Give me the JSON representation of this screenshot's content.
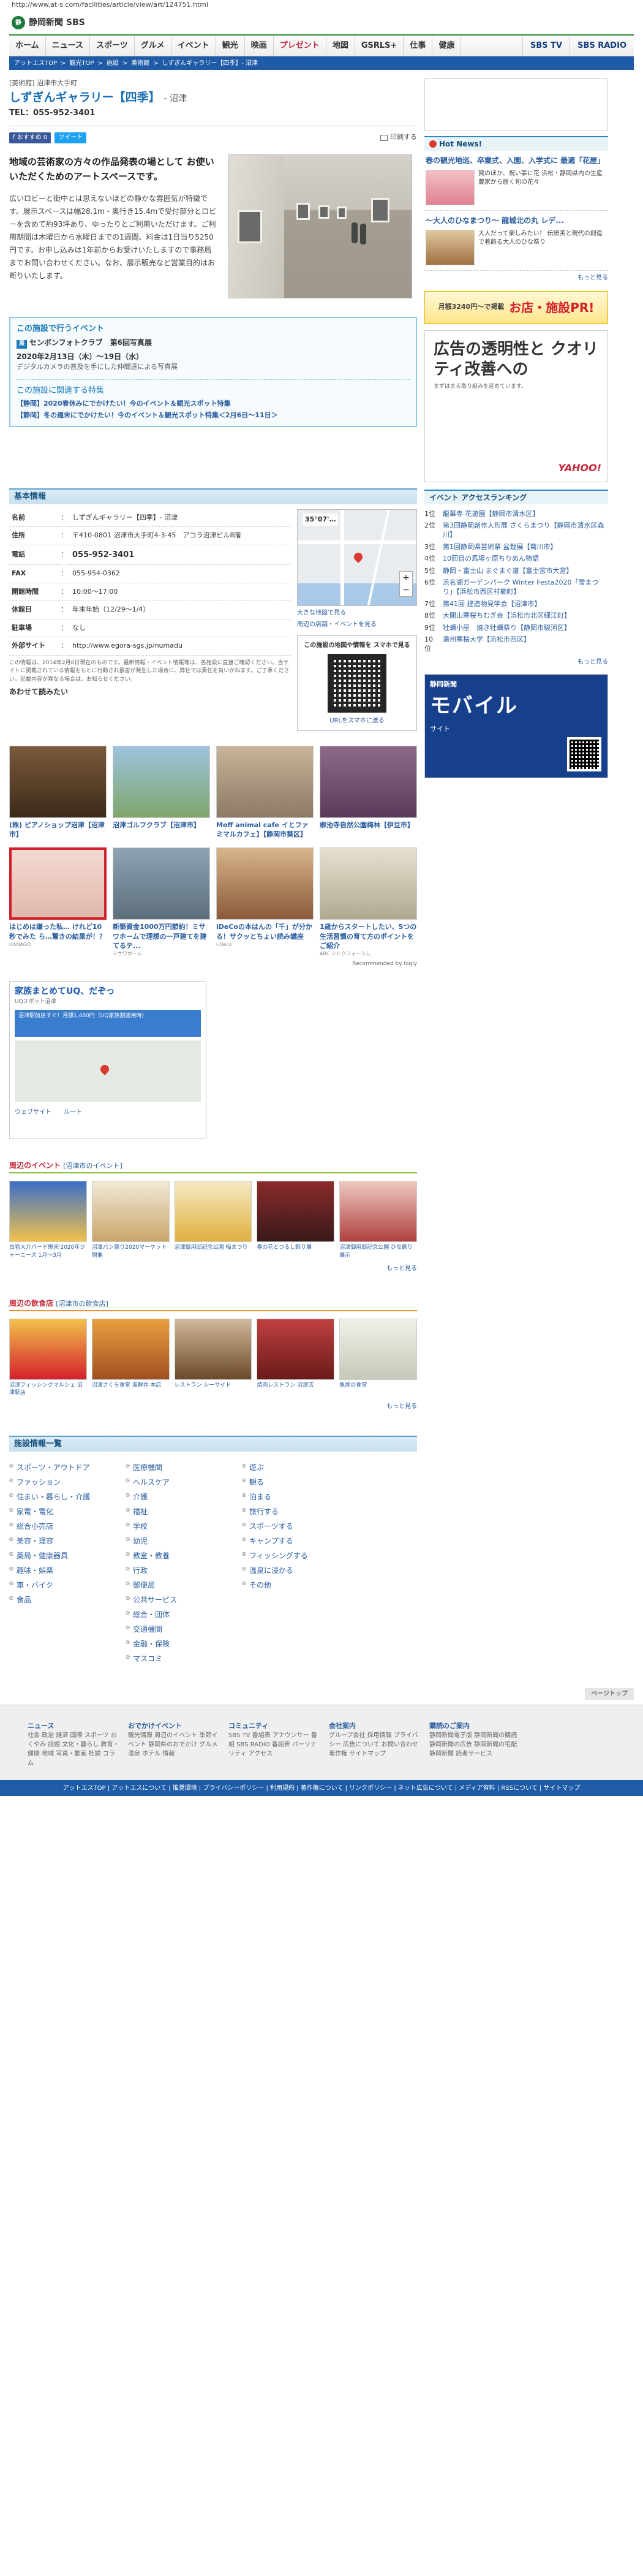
{
  "url": "http://www.at-s.com/facilities/article/view/art/124751.html",
  "header": {
    "logo_mark": "静",
    "logo_text": "静岡新聞 SBS",
    "right": ""
  },
  "gnav": {
    "items": [
      "ホーム",
      "ニュース",
      "スポーツ",
      "グルメ",
      "イベント",
      "観光",
      "映画",
      "プレゼント",
      "地図",
      "GSRLS+",
      "仕事",
      "健康"
    ],
    "brand1": "SBS TV",
    "brand2": "SBS RADIO"
  },
  "breadcrumb": [
    "アットエスTOP",
    "観光TOP",
    "施設",
    "美術館",
    "しずぎんギャラリー【四季】- 沼津"
  ],
  "page": {
    "category": "[美術館]",
    "area": "沼津市大手町",
    "title": "しずぎんギャラリー【四季】",
    "location": "- 沼津",
    "tel": "TEL：055-952-3401",
    "fb": "f おすすめ 0",
    "tw": "ツイート",
    "print": "印刷する"
  },
  "intro": {
    "lead": "地域の芸術家の方々の作品発表の場として お使いいただくためのアートスペースです。",
    "body": "広いロビーと街中とは思えないほどの静かな雰囲気が特徴です。展示スペースは幅28.1m・奥行き15.4mで受付部分とロビーを含めて約93坪あり、ゆったりとご利用いただけます。ご利用期間は木曜日から水曜日までの1週間、料金は1日当り5250円です。お申し込みは1年前からお受けいたしますので事務局までお問い合わせください。なお、展示販売など営業目的はお断りいたします。"
  },
  "access": {
    "heading": "この施設で行うイベント",
    "event_badge": "展",
    "event_title": "センボンフォトクラブ　第6回写真展",
    "event_date": "2020年2月13日（木）～19日（水）",
    "event_desc": "デジタルカメラの普及を手にした仲間達による写真展",
    "feat_heading": "この施設に関連する特集",
    "features": [
      "【静岡】2020春休みにでかけたい！今のイベント＆観光スポット特集",
      "【静岡】冬の週末にでかけたい！今のイベント＆観光スポット特集＜2月6日～11日＞"
    ]
  },
  "basic": {
    "heading": "基本情報",
    "rows": [
      {
        "k": "名前",
        "v": "しずぎんギャラリー【四季】- 沼津",
        "big": false
      },
      {
        "k": "住所",
        "v": "〒410-0801 沼津市大手町4-3-45　アコラ沼津ビル8階",
        "big": false
      },
      {
        "k": "電話",
        "v": "055-952-3401",
        "big": true
      },
      {
        "k": "FAX",
        "v": "055-954-0362",
        "big": false
      },
      {
        "k": "開館時間",
        "v": "10:00～17:00",
        "big": false
      },
      {
        "k": "休館日",
        "v": "年末年始（12/29～1/4）",
        "big": false
      },
      {
        "k": "駐車場",
        "v": "なし",
        "big": false
      },
      {
        "k": "外部サイト",
        "v": "http://www.egora-sgs.jp/numadu",
        "big": false
      }
    ],
    "note": "この情報は、2014年2月8日現在のものです。最新情報・イベント情報等は、各施設に直接ご確認ください。当サイトに掲載されている情報をもとに行動され損害が発生した場合に、弊社では責任を負いかねます。ご了承ください。記載内容が異なる場合は、お知らせください。",
    "also": "あわせて読みたい",
    "map_weather": "35°07'…",
    "map_link1": "大きな地図で見る",
    "map_link2": "周辺の店舗・イベントを見る",
    "qr_title": "この施設の地図や情報を スマホで見る",
    "qr_link": "URLをスマホに送る"
  },
  "thumbs": [
    {
      "cap": "(株) ピアノショップ沼津【沼津市】",
      "src": ""
    },
    {
      "cap": "沼津ゴルフクラブ【沼津市】",
      "src": ""
    },
    {
      "cap": "Moff animal cafe イとファミマルカフェ】【静岡市葵区】",
      "src": ""
    },
    {
      "cap": "柳池寺自然公園梅林【伊豆市】",
      "src": ""
    },
    {
      "cap": "はじめは嫌った私… けれど10秒でみた ら…驚きの結果が！？",
      "src": "HANAGO"
    },
    {
      "cap": "新築資金1000万円節約！ミサワホームで理想の一戸建てを建てるテ...",
      "src": "ミサワホーム"
    },
    {
      "cap": "iDeCoの本はんの「千」が分かる！サクッとちょい読み講座",
      "src": "i-Deco"
    },
    {
      "cap": "1歳からスタートしたい、5つの生活習慣の育て方のポイントをご紹介",
      "src": "ABC ミルクフォーラム"
    }
  ],
  "recommend": "Recommended by logly",
  "ad2": {
    "title": "家族まとめてUQ、だぞっ",
    "sub": "UQスポット沼津",
    "bar": "沼津駅前店すぐ！月額1,480円（UQ家族割適用時）",
    "btn1": "ウェブサイト",
    "btn2": "ルート"
  },
  "events": {
    "heading": "周辺のイベント",
    "sub": "[沼津市のイベント]",
    "items": [
      {
        "cap": "白岩大介バード飛来'2020年ジャーニーズ 1月～3月"
      },
      {
        "cap": "沼津パン祭り2020マーケット開催"
      },
      {
        "cap": "沼津御用邸記念公園 梅まつり"
      },
      {
        "cap": "春の花とつるし飾り展"
      },
      {
        "cap": "沼津御用邸記念公園 ひな飾り展示"
      }
    ],
    "more": "もっと見る"
  },
  "gourmet": {
    "heading": "周辺の飲食店",
    "sub": "[沼津市の飲食店]",
    "items": [
      {
        "cap": "沼津フィッシングマルシェ 沼津駅店"
      },
      {
        "cap": "沼津さくら食堂 海鮮丼 本店"
      },
      {
        "cap": "レストラン シーサイド"
      },
      {
        "cap": "焼肉レストラン 沼津店"
      },
      {
        "cap": "魚屋の食堂"
      }
    ],
    "more": "もっと見る"
  },
  "facilities": {
    "heading": "施設情報一覧",
    "col1": [
      "スポーツ・アウトドア",
      "ファッション",
      "住まい・暮らし・介護",
      "家電・電化",
      "総合小売店",
      "美容・理容",
      "薬局・健康器具",
      "趣味・娯楽",
      "車・バイク",
      "食品"
    ],
    "col2": [
      "医療機関",
      "ヘルスケア",
      "介護",
      "福祉",
      "学校",
      "幼児",
      "教室・教養",
      "行政",
      "郵便局",
      "公共サービス",
      "総合・団体",
      "交通機関",
      "金融・保険",
      "マスコミ"
    ],
    "col3": [
      "遊ぶ",
      "観る",
      "泊まる",
      "旅行する",
      "スポーツする",
      "キャンプする",
      "フィッシングする",
      "温泉に浸かる",
      "その他"
    ]
  },
  "side": {
    "hot_title": "Hot News!",
    "hot": [
      {
        "h": "春の観光地巡、卒業式、入園、入学式に 最適「花屋」",
        "d": "賀のほか、祝い事に花 浜松・静岡県内の生産農家から届く旬の花々"
      },
      {
        "h": "～大人のひなまつり～ 龍城北の丸 レデ...",
        "d": "大人だって楽しみたい！ 伝統美と現代の創造で着飾る大人のひな祭り"
      }
    ],
    "more": "もっと見る",
    "pr_a": "月額3240円〜で掲載",
    "pr_b": "お店・施設PR!",
    "bigad_q": "広告の透明性と クオリティ改善への",
    "bigad_q2": "まずはまる取り組みを進めています。",
    "bigad_logo": "YAHOO!",
    "rank_title": "イベント アクセスランキング",
    "rank": [
      {
        "n": "1位",
        "t": "龍華寺 花遊園【静岡市清水区】"
      },
      {
        "n": "2位",
        "t": "第3回静岡創作人形展 さくらまつり【静岡市清水区森川】"
      },
      {
        "n": "3位",
        "t": "第1回静岡県芸術祭 盆栽展【菊川市】"
      },
      {
        "n": "4位",
        "t": "10回目の馬場ヶ原ちりめん物語"
      },
      {
        "n": "5位",
        "t": "静岡・富士山 まぐまぐ道【富士宮市大宮】"
      },
      {
        "n": "6位",
        "t": "浜名湖ガーデンパーク Winter Festa2020「雪まつり」【浜松市西区村櫛町】"
      },
      {
        "n": "7位",
        "t": "第41回 建造物見学会【沼津市】"
      },
      {
        "n": "8位",
        "t": "大開山寒桜ちむぎ会【浜松市北区細江町】"
      },
      {
        "n": "9位",
        "t": "牡蠣小屋　焼き牡蠣祭り【静岡市駿河区】"
      },
      {
        "n": "10位",
        "t": "遠州寒桜大学【浜松市西区】"
      }
    ],
    "rank_more": "もっと見る",
    "mobile_t1": "静岡新聞",
    "mobile_t2": "モバイル",
    "mobile_t3": "サイト"
  },
  "footer": {
    "pagetop": "ページトップ",
    "cols": [
      {
        "h": "ニュース",
        "l": "社会 政治 経済 国際 スポーツ おくやみ 話題 文化・暮らし 教育・健康 地域 写真・動画 社説 コラム"
      },
      {
        "h": "おでかけイベント",
        "l": "観光情報 周辺のイベント 季節イベント 静岡県のおでかけ グルメ 温泉 ホテル 情報"
      },
      {
        "h": "コミュニティ",
        "l": "SBS TV 番組表 アナウンサー 番組 SBS RADIO 番組表 パーソナリティ アクセス"
      },
      {
        "h": "会社案内",
        "l": "グループ会社 採用情報 プライバシー 広告について お問い合わせ 著作権 サイトマップ"
      },
      {
        "h": "購読のご案内",
        "l": "静岡新聞電子版 静岡新聞の購読 静岡新聞の広告 静岡新聞の宅配 静岡新聞 読者サービス"
      }
    ],
    "bar": "アットエスTOP | アットエスについて | 推奨環境 | プライバシーポリシー | 利用規約 | 著作権について | リンクポリシー | ネット広告について | メディア資料 | RSSについて | サイトマップ"
  }
}
